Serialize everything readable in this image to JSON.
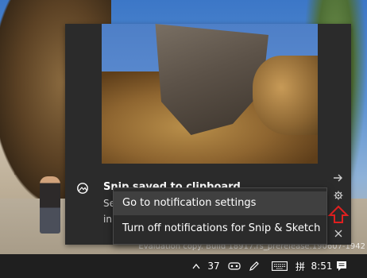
{
  "notification": {
    "title": "Snip saved to clipboard",
    "body_line1": "Se",
    "body_line2": "in"
  },
  "context_menu": {
    "items": [
      {
        "label": "Go to notification settings",
        "highlighted": true
      },
      {
        "label": "Turn off notifications for Snip & Sketch",
        "highlighted": false
      }
    ]
  },
  "watermark": {
    "text": "Evaluation copy. Build 18917.rs_prerelease.190607-1942"
  },
  "taskbar": {
    "tray_count": "37",
    "input_language": "拼",
    "time": "8:51"
  },
  "icons": {
    "app_icon": "snip-and-sketch-icon",
    "expand": "arrow-right-icon",
    "settings": "gear-icon",
    "dismiss": "close-icon",
    "annotation": "red-up-arrow-icon",
    "tray": [
      "chevron-up-icon",
      "people-icon",
      "pen-icon",
      "keyboard-icon",
      "action-center-icon"
    ]
  },
  "colors": {
    "toast_bg": "#2b2b2b",
    "menu_hover": "#404040",
    "taskbar_bg": "#1f1f1f",
    "annotation_red": "#e02020"
  }
}
